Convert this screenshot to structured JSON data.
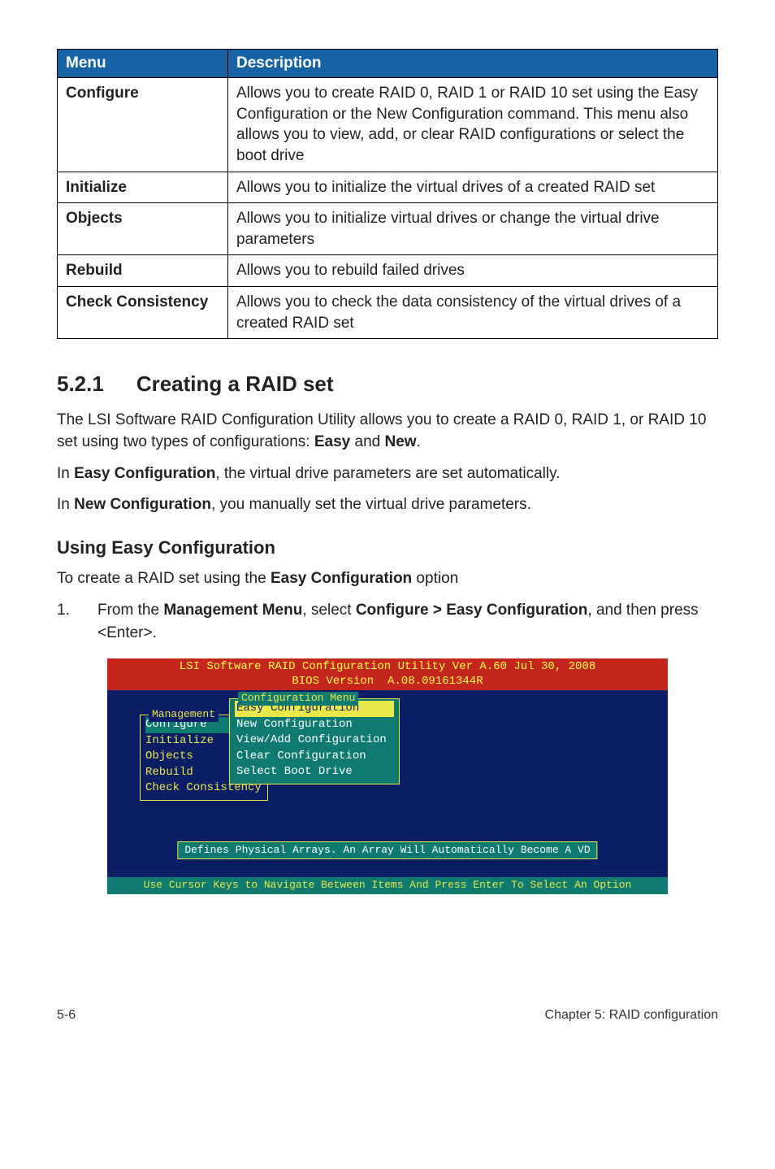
{
  "table": {
    "headers": {
      "menu": "Menu",
      "desc": "Description"
    },
    "rows": [
      {
        "menu": "Configure",
        "desc": "Allows you to create RAID 0, RAID 1 or RAID 10 set using the Easy Configuration or the New Configuration command. This menu also allows you to view, add, or clear RAID configurations or select the boot drive"
      },
      {
        "menu": "Initialize",
        "desc": "Allows you to initialize the virtual drives of a created RAID set"
      },
      {
        "menu": "Objects",
        "desc": "Allows you to initialize virtual drives or change the virtual drive parameters"
      },
      {
        "menu": "Rebuild",
        "desc": "Allows you to rebuild failed drives"
      },
      {
        "menu": "Check Consistency",
        "desc": "Allows you to check the data consistency of the virtual drives of a created RAID set"
      }
    ]
  },
  "section": {
    "number": "5.2.1",
    "title": "Creating a RAID set"
  },
  "para1_a": "The LSI Software RAID Configuration Utility allows you to create a RAID 0, RAID 1, or RAID 10 set using two types of configurations: ",
  "para1_b": "Easy",
  "para1_c": " and ",
  "para1_d": "New",
  "para1_e": ".",
  "para2_a": "In ",
  "para2_b": "Easy Configuration",
  "para2_c": ", the virtual drive parameters are set automatically.",
  "para3_a": "In ",
  "para3_b": "New Configuration",
  "para3_c": ", you manually set the virtual drive parameters.",
  "subheading": "Using Easy Configuration",
  "para4_a": "To create a RAID set using the ",
  "para4_b": "Easy Configuration",
  "para4_c": " option",
  "step1": {
    "num": "1.",
    "a": "From the ",
    "b": "Management Menu",
    "c": ", select ",
    "d": "Configure > Easy Configuration",
    "e": ", and then press <Enter>."
  },
  "bios": {
    "title1": "LSI Software RAID Configuration Utility Ver A.60 Jul 30, 2008",
    "title2": "BIOS Version  A.08.09161344R",
    "mgmt_title": "Management",
    "mgmt_items": [
      "Configure",
      "Initialize",
      "Objects",
      "Rebuild",
      "Check Consistency"
    ],
    "cfg_title": "Configuration Menu",
    "cfg_items": [
      "Easy Configuration",
      "New Configuration",
      "View/Add Configuration",
      "Clear Configuration",
      "Select Boot Drive"
    ],
    "status": "Defines Physical Arrays. An Array Will Automatically Become A VD",
    "footer": "Use Cursor Keys to Navigate Between Items And Press Enter To Select An Option"
  },
  "footer": {
    "left": "5-6",
    "right": "Chapter 5: RAID configuration"
  }
}
